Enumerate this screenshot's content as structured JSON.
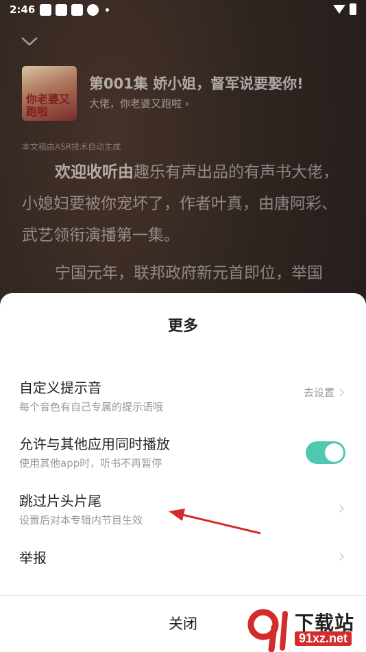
{
  "status_bar": {
    "time": "2:46"
  },
  "player": {
    "episode_title": "第001集 娇小姐，督军说要娶你!",
    "album_link": "大佬，你老婆又跑啦",
    "cover_text": "你老婆又跑啦",
    "asr_note": "本文稿由ASR技术自动生成",
    "para1_bold": "欢迎收听由",
    "para1_rest": "趣乐有声出品的有声书大佬，小媳妇要被你宠坏了，作者叶真，由唐阿彩、武艺领衔演播第一集。",
    "para2": "宁国元年，联邦政府新元首即位，举国"
  },
  "sheet": {
    "title": "更多",
    "items": [
      {
        "title": "自定义提示音",
        "subtitle": "每个音色有自己专属的提示语哦",
        "value": "去设置"
      },
      {
        "title": "允许与其他应用同时播放",
        "subtitle": "使用其他app时，听书不再暂停",
        "toggle_on": true
      },
      {
        "title": "跳过片头片尾",
        "subtitle": "设置后对本专辑内节目生效"
      },
      {
        "title": "举报"
      }
    ],
    "close_label": "关闭"
  },
  "watermark": {
    "line1": "下载站",
    "line2": "91xz.net"
  },
  "colors": {
    "toggle_on": "#4ec9b0",
    "arrow": "#d42b2b"
  }
}
